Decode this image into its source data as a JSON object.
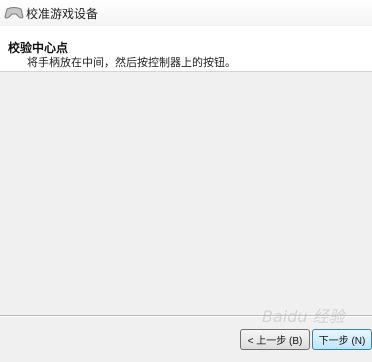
{
  "window": {
    "title": "校准游戏设备",
    "icon": "gamepad-icon"
  },
  "header": {
    "title": "校验中心点",
    "instruction": "将手柄放在中间，然后按控制器上的按钮。"
  },
  "buttons": {
    "back_label": "< 上一步 (B)",
    "next_label": "下一步 (N)"
  },
  "watermark": {
    "text": "Baidu 经验"
  }
}
